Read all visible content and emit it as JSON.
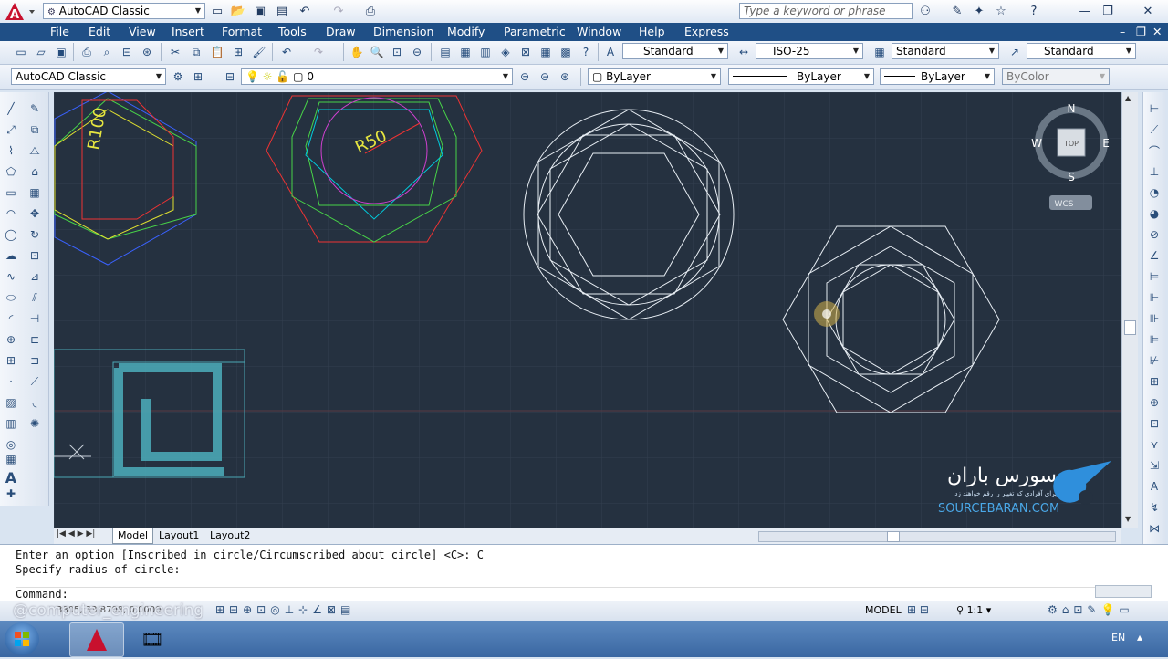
{
  "titlebar": {
    "workspace": "AutoCAD Classic",
    "search_placeholder": "Type a keyword or phrase"
  },
  "menu": [
    "File",
    "Edit",
    "View",
    "Insert",
    "Format",
    "Tools",
    "Draw",
    "Dimension",
    "Modify",
    "Parametric",
    "Window",
    "Help",
    "Express"
  ],
  "styles": {
    "text_style": "Standard",
    "dim_style": "ISO-25",
    "table_style": "Standard",
    "mleader_style": "Standard"
  },
  "layers": {
    "workspace": "AutoCAD Classic",
    "layer": "0",
    "color": "ByLayer",
    "linetype": "ByLayer",
    "lineweight": "ByLayer",
    "plotstyle": "ByColor"
  },
  "drawing": {
    "dim_r100": "R100",
    "dim_r50": "R50",
    "viewcube": {
      "n": "N",
      "s": "S",
      "e": "E",
      "w": "W",
      "top": "TOP",
      "wcs": "WCS"
    }
  },
  "watermark": {
    "persian_name": "سورس باران",
    "persian_tagline": "برای آفرادی که تغییر را رقم خواهند زد",
    "latin": "SOURCEBARAN.COM"
  },
  "tabs": [
    "Model",
    "Layout1",
    "Layout2"
  ],
  "command": {
    "line1": "Enter an option [Inscribed in circle/Circumscribed about circle] <C>: C",
    "line2": "Specify radius of circle:",
    "prompt": "Command:"
  },
  "status": {
    "coords": "3805, 33.8708, 0.0000",
    "overlay": "@computer_engineering",
    "model": "MODEL",
    "scale": "1:1"
  },
  "taskbar": {
    "lang": "EN"
  },
  "colors": {
    "canvas": "#253140",
    "menubar": "#1f4f86",
    "accent": "#c8102e"
  }
}
